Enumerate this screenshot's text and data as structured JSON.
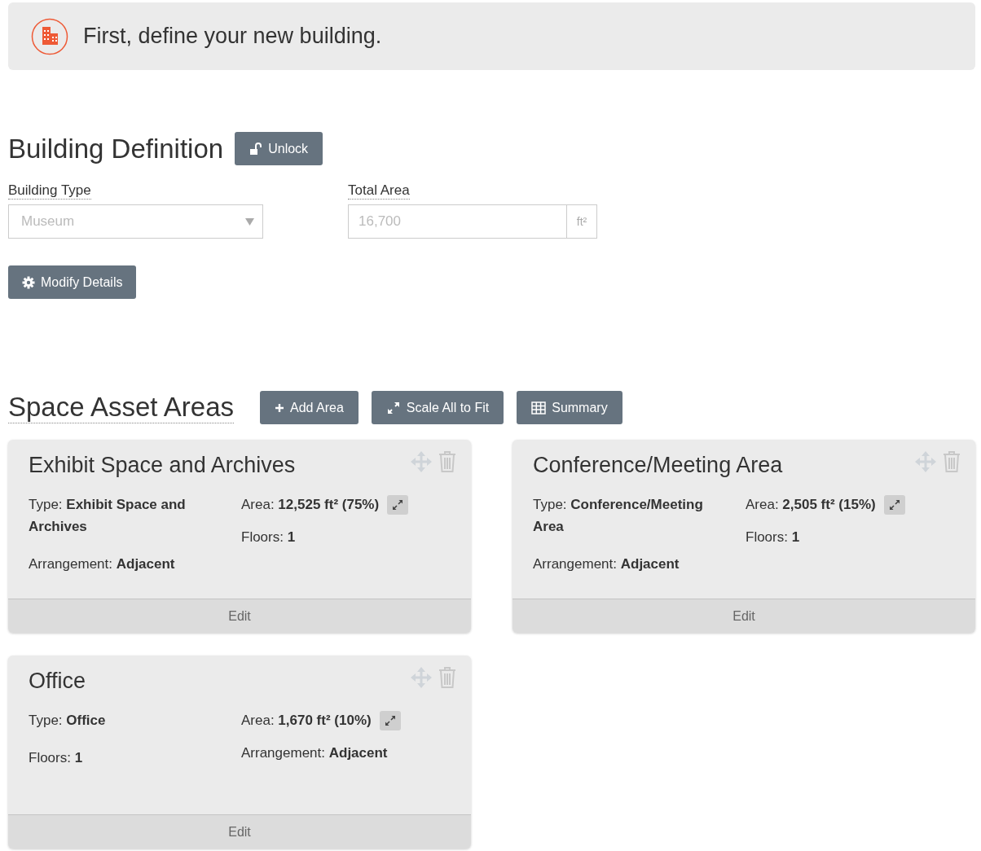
{
  "banner": {
    "text": "First, define your new building."
  },
  "building_definition": {
    "title": "Building Definition",
    "lock_button": "Unlock",
    "fields": [
      {
        "kind": "select",
        "label": "Building Type",
        "value": "Museum",
        "disabled": true
      },
      {
        "kind": "number",
        "label": "Total Area",
        "value": "16,700",
        "unit": "ft²",
        "disabled": true
      }
    ],
    "modify_button": "Modify Details"
  },
  "space_asset_areas": {
    "title": "Space Asset Areas",
    "buttons": [
      {
        "kind": "add",
        "label": "Add Area"
      },
      {
        "kind": "scale",
        "label": "Scale All to Fit"
      },
      {
        "kind": "summary",
        "label": "Summary"
      }
    ],
    "cards": [
      {
        "title": "Exhibit Space and Archives",
        "left_fields": [
          {
            "kind": "text",
            "text": "Type: **Exhibit Space and Archives**"
          },
          {
            "kind": "text",
            "text": "Arrangement: **Adjacent**"
          }
        ],
        "right_fields": [
          {
            "kind": "area",
            "text": "Area: **12,525 ft² (75%)**"
          },
          {
            "kind": "text",
            "text": "Floors: **1**"
          }
        ],
        "edit": "Edit"
      },
      {
        "title": "Conference/Meeting Area",
        "left_fields": [
          {
            "kind": "text",
            "text": "Type: **Conference/Meeting Area**"
          },
          {
            "kind": "text",
            "text": "Arrangement: **Adjacent**"
          }
        ],
        "right_fields": [
          {
            "kind": "area",
            "text": "Area: **2,505 ft² (15%)**"
          },
          {
            "kind": "text",
            "text": "Floors: **1**"
          }
        ],
        "edit": "Edit"
      },
      {
        "title": "Office",
        "left_fields": [
          {
            "kind": "text",
            "text": "Type: **Office**"
          },
          {
            "kind": "text",
            "text": "Floors: **1**"
          }
        ],
        "right_fields": [
          {
            "kind": "area",
            "text": "Area: **1,670 ft² (10%)**"
          },
          {
            "kind": "text",
            "text": "Arrangement: **Adjacent**"
          }
        ],
        "edit": "Edit"
      }
    ]
  }
}
